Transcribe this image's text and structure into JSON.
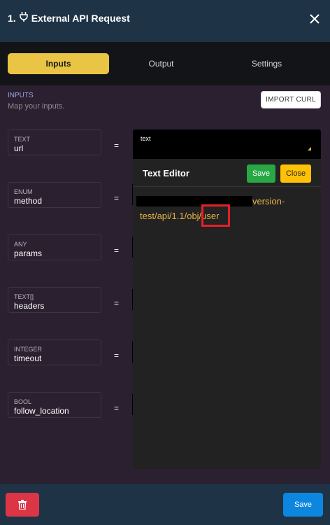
{
  "header": {
    "title": "1. ⭑ External API Request",
    "title_text": "External API Request",
    "title_prefix": "1.",
    "plug_icon": "plug-icon",
    "close_icon": "close-icon"
  },
  "tabs": [
    {
      "label": "Inputs",
      "active": true
    },
    {
      "label": "Output",
      "active": false
    },
    {
      "label": "Settings",
      "active": false
    }
  ],
  "inputs_section": {
    "title": "INPUTS",
    "subtitle": "Map your inputs.",
    "import_button": "IMPORT CURL"
  },
  "params": [
    {
      "type": "TEXT",
      "name": "url"
    },
    {
      "type": "ENUM",
      "name": "method"
    },
    {
      "type": "ANY",
      "name": "params"
    },
    {
      "type": "TEXT[]",
      "name": "headers"
    },
    {
      "type": "INTEGER",
      "name": "timeout"
    },
    {
      "type": "BOOL",
      "name": "follow_location"
    }
  ],
  "equals_sign": "=",
  "text_input": {
    "hint": "text"
  },
  "editor": {
    "title": "Text Editor",
    "save_label": "Save",
    "close_label": "Close",
    "line1_visible": "version-",
    "line2": "test/api/1.1/obj/user"
  },
  "footer": {
    "trash_icon": "trash-icon",
    "save_label": "Save"
  },
  "colors": {
    "header_bg": "#1e3346",
    "tab_active": "#eac444",
    "panel_bg": "#2b2030",
    "editor_text": "#e7b546",
    "highlight": "#e32127",
    "save_green": "#28a745",
    "close_yellow": "#ffc107",
    "delete_red": "#dc3545",
    "save_blue": "#0d86e0"
  }
}
